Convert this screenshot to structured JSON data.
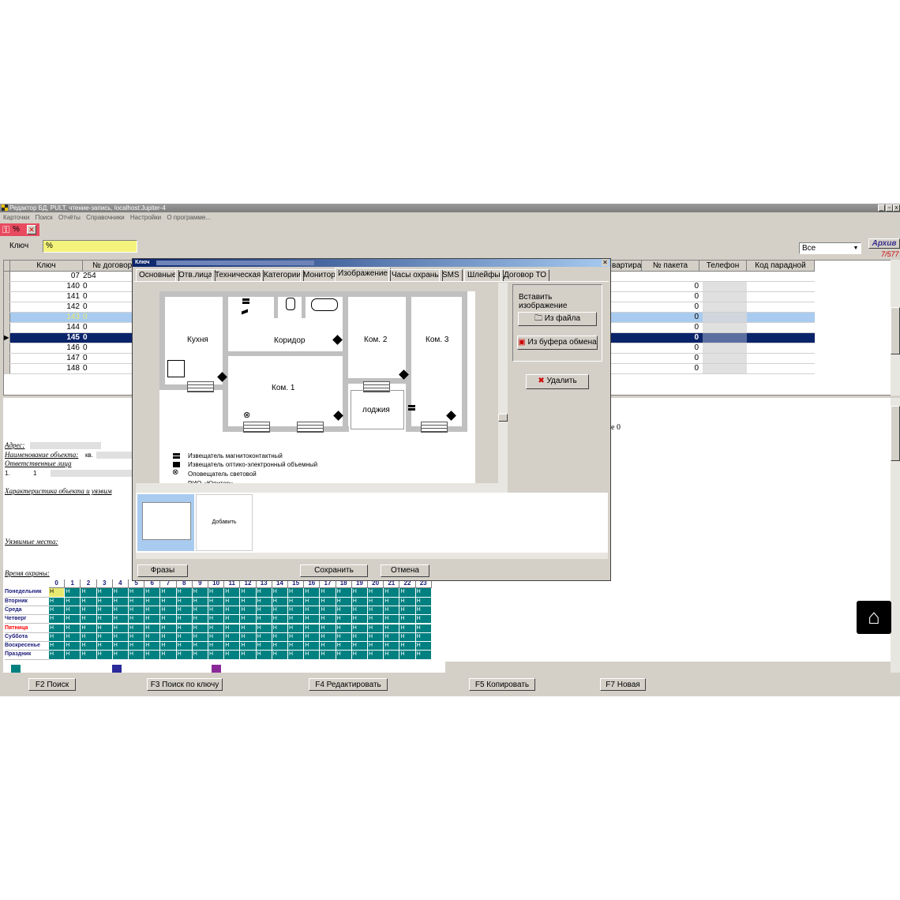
{
  "window": {
    "title": "Редактор БД, PULT, чтение-запись, localhost:Jupiter-4",
    "menu": [
      "Карточки",
      "Поиск",
      "Отчёты",
      "Справочники",
      "Настройки",
      "О программе..."
    ]
  },
  "filter": {
    "key_label": "Ключ",
    "key_value": "%",
    "tab_label": "%",
    "combo_value": "Все",
    "archive_label": "Архив",
    "archive_count": "7/577"
  },
  "grid": {
    "headers": [
      "Ключ",
      "№ договора",
      "вартира",
      "№ пакета",
      "Телефон",
      "Код парадной"
    ],
    "rows": [
      {
        "key": "07",
        "contract": "254",
        "pack": ""
      },
      {
        "key": "140",
        "contract": "0",
        "pack": "0"
      },
      {
        "key": "141",
        "contract": "0",
        "pack": "0"
      },
      {
        "key": "142",
        "contract": "0",
        "pack": "0"
      },
      {
        "key": "143",
        "contract": "0",
        "pack": "0"
      },
      {
        "key": "144",
        "contract": "0",
        "pack": "0"
      },
      {
        "key": "145",
        "contract": "0",
        "pack": "0"
      },
      {
        "key": "146",
        "contract": "0",
        "pack": "0"
      },
      {
        "key": "147",
        "contract": "0",
        "pack": "0"
      },
      {
        "key": "148",
        "contract": "0",
        "pack": "0"
      }
    ]
  },
  "detail": {
    "address_label": "Адрес:",
    "name_label": "Наименование объекта:",
    "name_value": "кв.",
    "responsible_label": "Ответственные лица",
    "resp_num": "1.",
    "resp_val": "1",
    "char_label": "Характеристика объекта и уязвим",
    "weak_label": "Уязвимые места:",
    "time_label": "Время охраны:",
    "right_value": "е 0"
  },
  "schedule": {
    "hours": [
      "0",
      "1",
      "2",
      "3",
      "4",
      "5",
      "6",
      "7",
      "8",
      "9",
      "10",
      "11",
      "12",
      "13",
      "14",
      "15",
      "16",
      "17",
      "18",
      "19",
      "20",
      "21",
      "22",
      "23"
    ],
    "days": [
      "Понедельник",
      "Вторник",
      "Среда",
      "Четверг",
      "Пятница",
      "Суббота",
      "Воскресенье",
      "Праздник"
    ],
    "cell": "Н",
    "cell_color": "#008080",
    "friday_color": "#ff0000"
  },
  "dialog": {
    "title": "Ключ",
    "tabs": [
      "Основные",
      "Отв.лица",
      "Техническая",
      "Категории",
      "Монитор",
      "Изображение",
      "Часы охраны",
      "SMS",
      "Шлейфы",
      "Договор ТО"
    ],
    "active_tab": "Изображение",
    "insert_label": "Вставить изображение",
    "from_file": "Из файла",
    "from_clipboard": "Из буфера обмена",
    "delete": "Удалить",
    "add_label": "Добавить",
    "phrases": "Фразы",
    "save": "Сохранить",
    "cancel": "Отмена",
    "plan": {
      "rooms": [
        "Кухня",
        "Коридор",
        "Ком. 2",
        "Ком. 3",
        "Ком. 1",
        "лоджия"
      ],
      "legend": [
        "Извещатель магнитоконтактный",
        "Извещатель оптико-электронный объемный",
        "Оповещатель световой",
        "РИО «Юпитер»"
      ]
    }
  },
  "fkeys": [
    "F2 Поиск",
    "F3 Поиск по ключу",
    "F4 Редактировать",
    "F5 Копировать",
    "F7 Новая"
  ]
}
